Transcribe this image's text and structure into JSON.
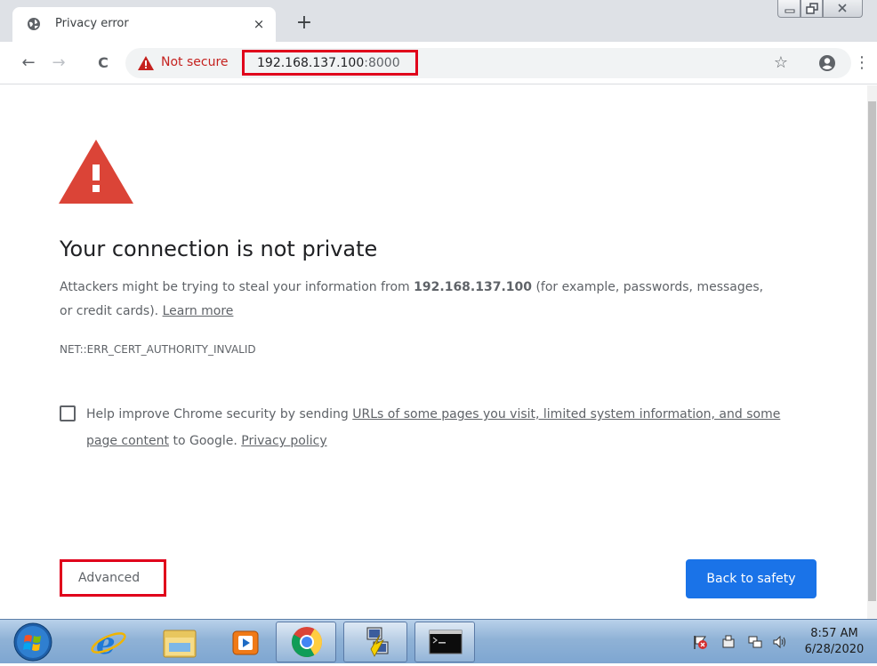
{
  "tab": {
    "title": "Privacy error",
    "close_glyph": "×",
    "new_tab_glyph": "+"
  },
  "toolbar": {
    "back_glyph": "←",
    "forward_glyph": "→",
    "reload_glyph": "C",
    "not_secure_label": "Not secure",
    "url_host": "192.168.137.100",
    "url_port": ":8000",
    "star_glyph": "☆",
    "menu_glyph": "⋮"
  },
  "page": {
    "heading": "Your connection is not private",
    "body_prefix": "Attackers might be trying to steal your information from ",
    "body_host": "192.168.137.100",
    "body_suffix": " (for example, passwords, messages, or credit cards). ",
    "learn_more": "Learn more",
    "error_code": "NET::ERR_CERT_AUTHORITY_INVALID",
    "checkbox_prefix": "Help improve Chrome security by sending ",
    "checkbox_link": "URLs of some pages you visit, limited system information, and some page content",
    "checkbox_middle": " to Google. ",
    "privacy_policy": "Privacy policy",
    "advanced_label": "Advanced",
    "back_label": "Back to safety"
  },
  "taskbar": {
    "clock_time": "8:57 AM",
    "clock_date": "6/28/2020"
  },
  "colors": {
    "not_secure_red": "#c5221f",
    "highlight_red": "#e0001b",
    "primary_blue": "#1a73e8",
    "warning_red": "#db4437"
  }
}
